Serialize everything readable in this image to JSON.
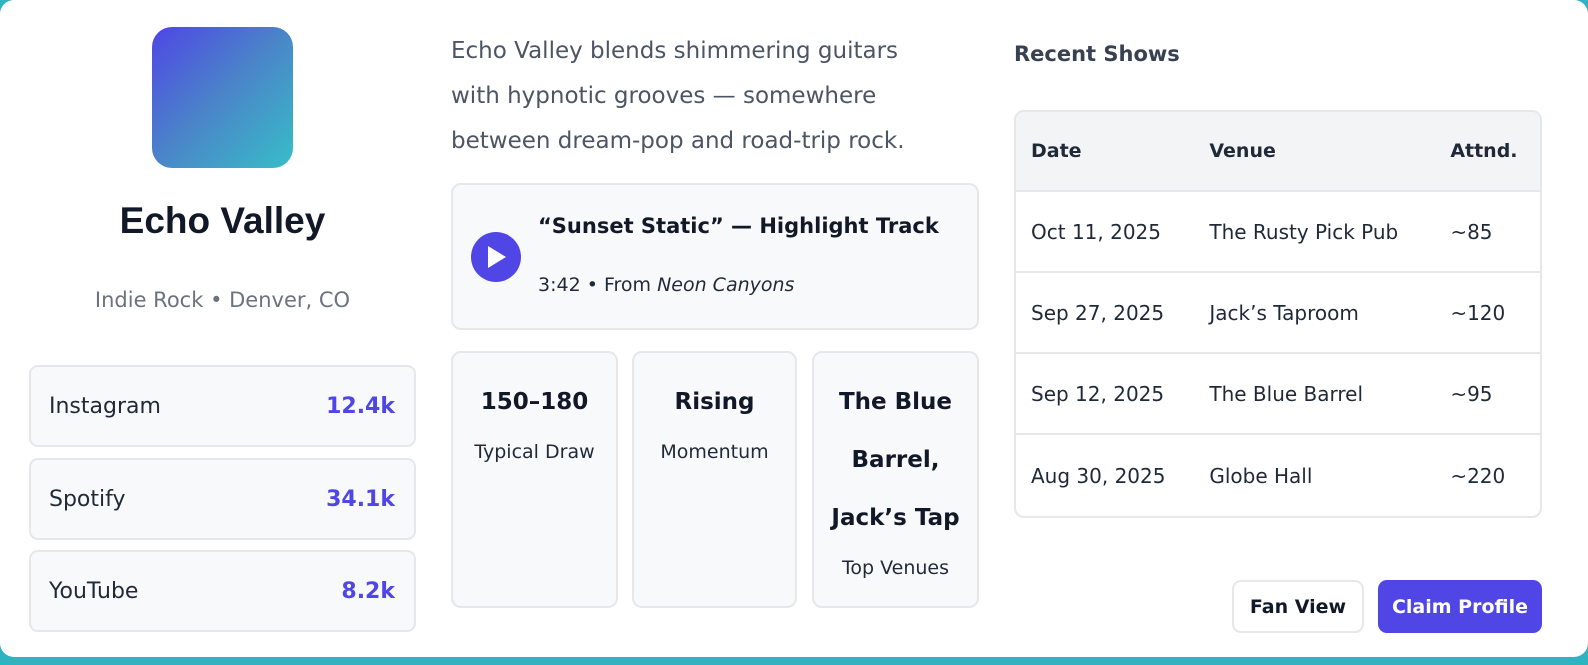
{
  "artist": {
    "name": "Echo Valley",
    "meta": "Indie Rock • Denver, CO",
    "avatar_gradient": [
      "#4f46e5",
      "#38bdc8"
    ]
  },
  "socials": [
    {
      "label": "Instagram",
      "value": "12.4k"
    },
    {
      "label": "Spotify",
      "value": "34.1k"
    },
    {
      "label": "YouTube",
      "value": "8.2k"
    }
  ],
  "bio": "Echo Valley blends shimmering guitars with hypnotic grooves — somewhere between dream-pop and road-trip rock.",
  "track": {
    "play_icon": "play-icon",
    "title": "“Sunset Static” — Highlight Track",
    "meta_prefix": "3:42 • From ",
    "album": "Neon Canyons"
  },
  "tiles": [
    {
      "value": "150–180",
      "label": "Typical Draw"
    },
    {
      "value": "Rising",
      "label": "Momentum"
    },
    {
      "value": "The Blue Barrel, Jack’s Tap",
      "label": "Top Venues"
    }
  ],
  "shows": {
    "title": "Recent Shows",
    "headers": [
      "Date",
      "Venue",
      "Attnd."
    ],
    "rows": [
      [
        "Oct 11, 2025",
        "The Rusty Pick Pub",
        "~85"
      ],
      [
        "Sep 27, 2025",
        "Jack’s Taproom",
        "~120"
      ],
      [
        "Sep 12, 2025",
        "The Blue Barrel",
        "~95"
      ],
      [
        "Aug 30, 2025",
        "Globe Hall",
        "~220"
      ]
    ]
  },
  "actions": {
    "fan_view": "Fan View",
    "claim_profile": "Claim Profile"
  },
  "colors": {
    "accent": "#4f46e5",
    "backdrop": "#2fb3c0"
  }
}
